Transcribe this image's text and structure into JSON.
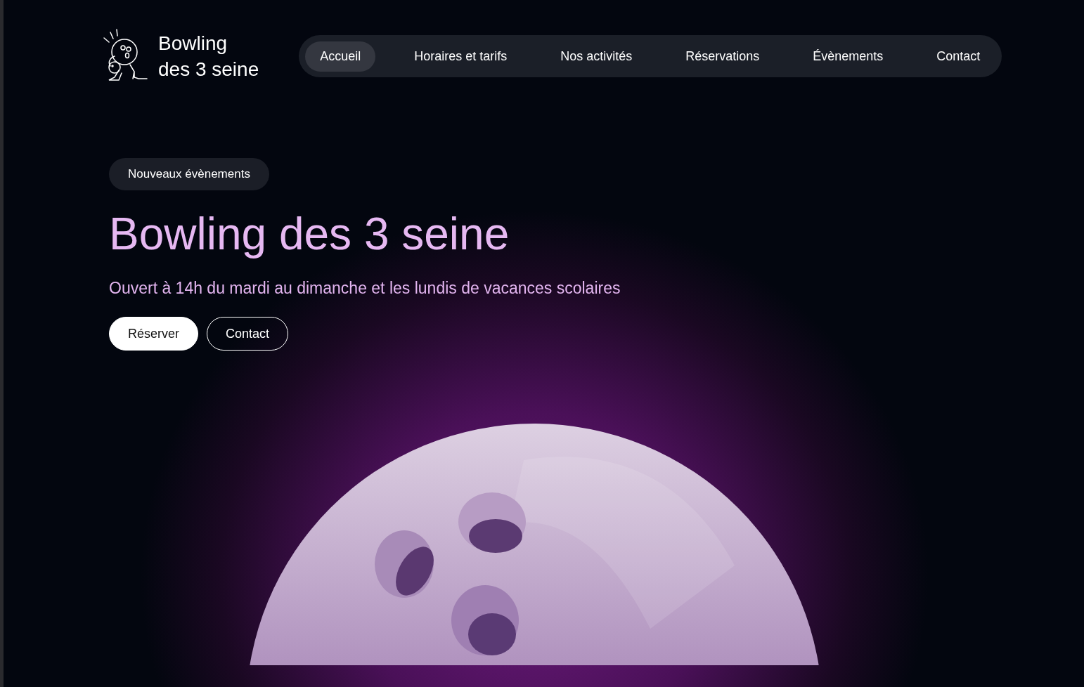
{
  "logo": {
    "lines": [
      "Bowling",
      "des 3 seine"
    ]
  },
  "nav": [
    {
      "label": "Accueil",
      "selected": true
    },
    {
      "label": "Horaires et tarifs",
      "selected": false
    },
    {
      "label": "Nos activités",
      "selected": false
    },
    {
      "label": "Réservations",
      "selected": false
    },
    {
      "label": "Évènements",
      "selected": false
    },
    {
      "label": "Contact",
      "selected": false
    }
  ],
  "hero": {
    "badge": "Nouveaux évènements",
    "title": "Bowling des 3 seine",
    "subtitle": "Ouvert à 14h du mardi au dimanche et les lundis de vacances scolaires",
    "buttons": [
      {
        "label": "Réserver",
        "kind": "primary"
      },
      {
        "label": "Contact",
        "kind": "outline"
      }
    ]
  }
}
